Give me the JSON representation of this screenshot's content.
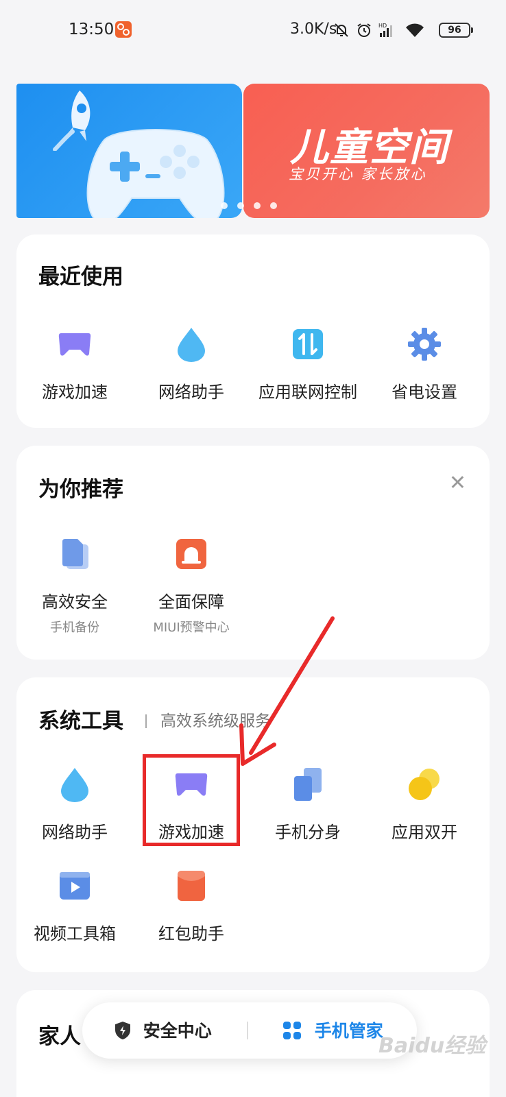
{
  "status_bar": {
    "time": "13:50",
    "net_speed": "3.0K/s",
    "battery": "96"
  },
  "banner": {
    "slides": [
      {
        "name": "game-boost-slide"
      },
      {
        "title": "儿童空间",
        "subtitle": "宝贝开心  家长放心"
      }
    ],
    "active_dot": 0,
    "dot_count": 4
  },
  "recent": {
    "title": "最近使用",
    "items": [
      {
        "label": "游戏加速",
        "icon": "gamepad-icon",
        "color": "#8a7df5"
      },
      {
        "label": "网络助手",
        "icon": "water-drop-icon",
        "color": "#4fb8f3"
      },
      {
        "label": "应用联网控制",
        "icon": "network-control-icon",
        "color": "#3fb7ef"
      },
      {
        "label": "省电设置",
        "icon": "gear-icon",
        "color": "#5b8de6"
      }
    ]
  },
  "recommend": {
    "title": "为你推荐",
    "items": [
      {
        "label": "高效安全",
        "sub": "手机备份",
        "icon": "backup-icon",
        "color": "#6f9ae8"
      },
      {
        "label": "全面保障",
        "sub": "MIUI预警中心",
        "icon": "alarm-icon",
        "color": "#f0653f"
      }
    ]
  },
  "tools": {
    "title": "系统工具",
    "subtitle": "高效系统级服务",
    "items": [
      {
        "label": "网络助手",
        "icon": "water-drop-icon",
        "color": "#4fb8f3"
      },
      {
        "label": "游戏加速",
        "icon": "gamepad-icon",
        "color": "#8a7df5"
      },
      {
        "label": "手机分身",
        "icon": "dual-phone-icon",
        "color": "#5b8de6"
      },
      {
        "label": "应用双开",
        "icon": "dual-app-icon",
        "color": "#f5c518"
      },
      {
        "label": "视频工具箱",
        "icon": "video-toolbox-icon",
        "color": "#5b8de6"
      },
      {
        "label": "红包助手",
        "icon": "red-packet-icon",
        "color": "#f06440"
      }
    ]
  },
  "family": {
    "title": "家人"
  },
  "bottom_nav": {
    "security": "安全中心",
    "manager": "手机管家",
    "manager_color": "#1d86e8"
  },
  "watermark": "Baidu经验"
}
